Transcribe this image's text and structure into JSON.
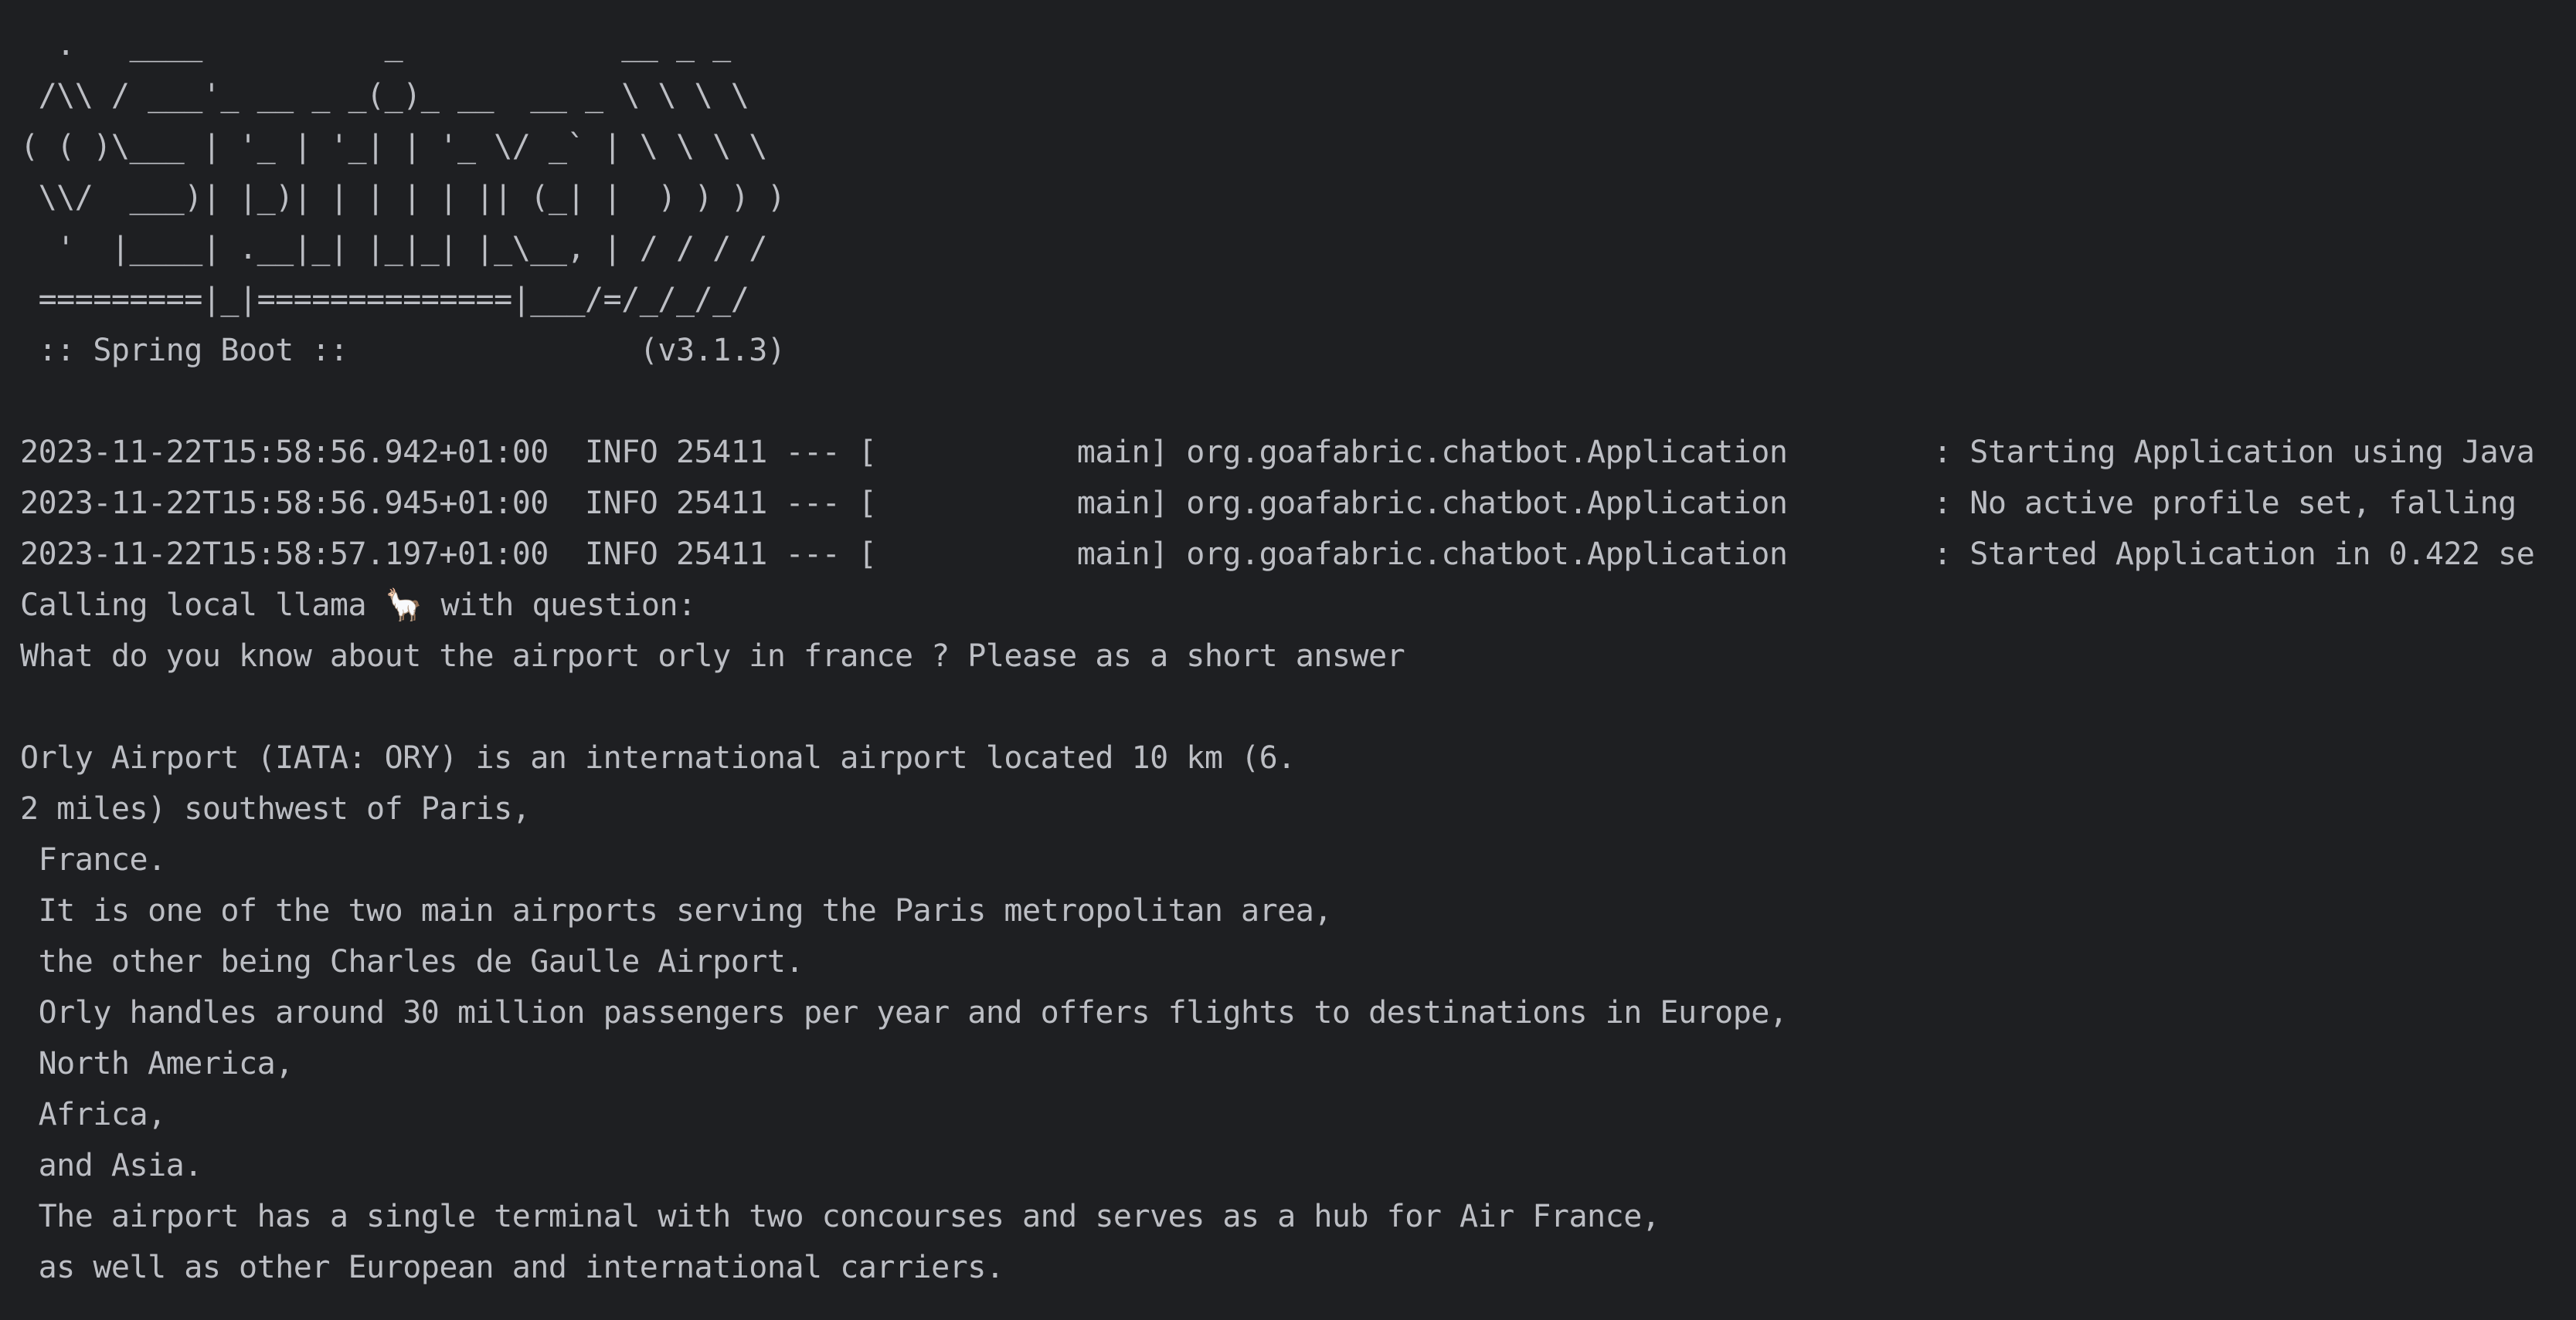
{
  "console": {
    "banner": [
      "  .   ____          _            __ _ _",
      " /\\\\ / ___'_ __ _ _(_)_ __  __ _ \\ \\ \\ \\",
      "( ( )\\___ | '_ | '_| | '_ \\/ _` | \\ \\ \\ \\",
      " \\\\/  ___)| |_)| | | | | || (_| |  ) ) ) )",
      "  '  |____| .__|_| |_|_| |_\\__, | / / / /",
      " =========|_|==============|___/=/_/_/_/",
      " :: Spring Boot ::                (v3.1.3)"
    ],
    "log_lines": [
      "2023-11-22T15:58:56.942+01:00  INFO 25411 --- [           main] org.goafabric.chatbot.Application        : Starting Application using Java",
      "2023-11-22T15:58:56.945+01:00  INFO 25411 --- [           main] org.goafabric.chatbot.Application        : No active profile set, falling",
      "2023-11-22T15:58:57.197+01:00  INFO 25411 --- [           main] org.goafabric.chatbot.Application        : Started Application in 0.422 se"
    ],
    "question_header": "Calling local llama 🦙 with question:",
    "question": "What do you know about the airport orly in france ? Please as a short answer",
    "answer_lines": [
      "Orly Airport (IATA: ORY) is an international airport located 10 km (6.",
      "2 miles) southwest of Paris,",
      " France.",
      " It is one of the two main airports serving the Paris metropolitan area,",
      " the other being Charles de Gaulle Airport.",
      " Orly handles around 30 million passengers per year and offers flights to destinations in Europe,",
      " North America,",
      " Africa,",
      " and Asia.",
      " The airport has a single terminal with two concourses and serves as a hub for Air France,",
      " as well as other European and international carriers."
    ]
  }
}
